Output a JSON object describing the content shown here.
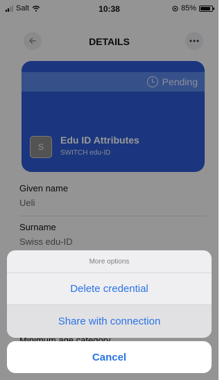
{
  "status_bar": {
    "carrier": "Salt",
    "time": "10:38",
    "battery": "85%"
  },
  "header": {
    "title": "DETAILS",
    "back_icon": "arrow-left-icon",
    "more_icon": "more-horizontal-icon"
  },
  "card": {
    "status": "Pending",
    "status_icon": "clock-icon",
    "avatar_letter": "S",
    "title": "Edu ID Attributes",
    "subtitle": "SWITCH edu-ID",
    "color": "#2d5bd3"
  },
  "attributes": [
    {
      "label": "Given name",
      "value": "Ueli"
    },
    {
      "label": "Surname",
      "value": "Swiss edu-ID"
    },
    {
      "label": "Minimum age category",
      "value": ""
    }
  ],
  "action_sheet": {
    "title": "More options",
    "options": [
      "Delete credential",
      "Share with connection"
    ],
    "cancel": "Cancel",
    "accent": "#2a73e6"
  }
}
